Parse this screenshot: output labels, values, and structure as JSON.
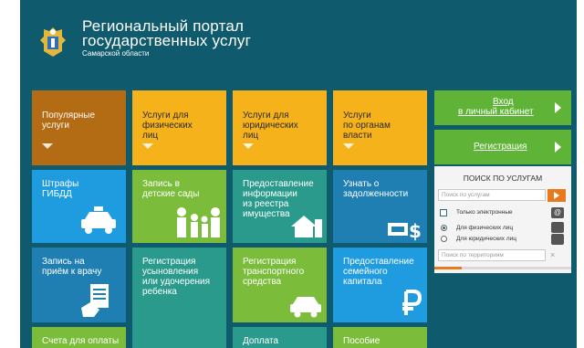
{
  "header": {
    "title_line1": "Региональный портал",
    "title_line2": "государственных услуг",
    "title_line3": "Самарской области",
    "logo": "coat-of-arms-icon"
  },
  "tiles_row1": [
    {
      "label": "Популярные\nуслуги",
      "color": "#b36b14"
    },
    {
      "label": "Услуги для\nфизических\nлиц",
      "color": "#f5b21a"
    },
    {
      "label": "Услуги для\nюридических\nлиц",
      "color": "#f5b21a"
    },
    {
      "label": "Услуги\nпо органам\nвласти",
      "color": "#f5b21a"
    }
  ],
  "tiles_row2": [
    {
      "label": "Штрафы\nГИБДД",
      "color": "#1f9be0",
      "icon": "police-car-icon"
    },
    {
      "label": "Запись в\nдетские сады",
      "color": "#7bbd3b",
      "icon": "family-icon"
    },
    {
      "label": "Предоставление\nинформации\nиз реестра\nимущества",
      "color": "#2a9a8c",
      "icon": "house-icon"
    },
    {
      "label": "Узнать о\nзадолженности",
      "color": "#1f7fb3",
      "icon": "money-icon"
    }
  ],
  "tiles_row3": [
    {
      "label": "Запись на\nприём к врачу",
      "color": "#1f7fb3",
      "icon": "document-hand-icon"
    },
    {
      "label": "Регистрация\nусыновления\nили удочерения\nребенка",
      "color": "#2a9a8c"
    },
    {
      "label": "Регистрация\nтранспортного\nсредства",
      "color": "#7bbd3b",
      "icon": "car-icon"
    },
    {
      "label": "Предоставление\nсемейного\nкапитала",
      "color": "#1f9be0",
      "icon": "ruble-icon"
    }
  ],
  "tiles_row4": [
    {
      "label": "Счета для оплаты",
      "color": "#7bbd3b"
    },
    {
      "label": "Доплата",
      "color": "#2a9a8c"
    },
    {
      "label": "Пособие",
      "color": "#7bbd3b"
    }
  ],
  "sidebar": {
    "login_line1": "Вход",
    "login_line2": "в личный кабинет",
    "register": "Регистрация",
    "accent": "#5fb336"
  },
  "search_panel": {
    "title": "ПОИСК ПО УСЛУГАМ",
    "search_placeholder": "Поиск по услугам",
    "only_electronic": "Только электронные",
    "for_individuals": "Для физических лиц",
    "for_legal": "Для юридических лиц",
    "territory_placeholder": "Поиск по территориям",
    "clear": "×",
    "progress": 0.2,
    "mini_icon1": "@"
  }
}
